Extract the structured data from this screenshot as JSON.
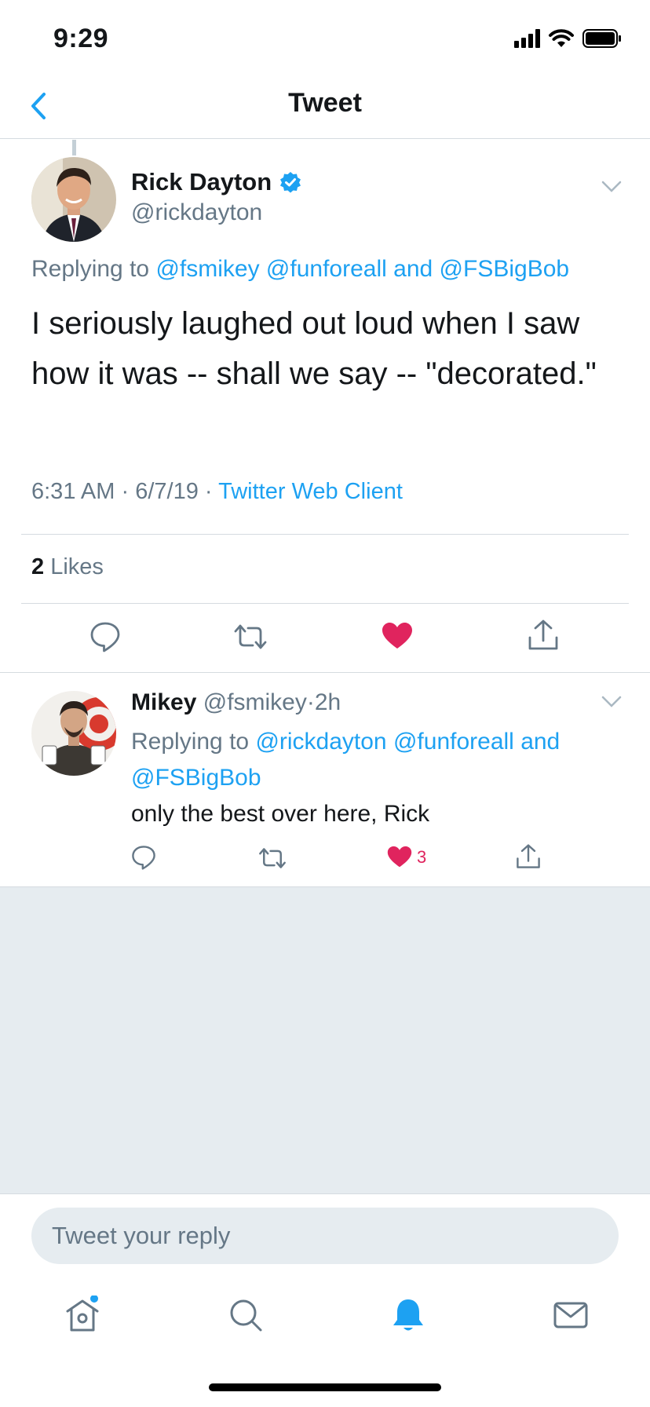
{
  "status_bar": {
    "time": "9:29"
  },
  "nav": {
    "title": "Tweet"
  },
  "main_tweet": {
    "author_name": "Rick Dayton",
    "author_handle": "@rickdayton",
    "replying_prefix": "Replying to ",
    "mention_1": "@fsmikey",
    "mention_2": "@funforeall",
    "and_word": "and",
    "mention_3": "@FSBigBob",
    "text": "I seriously laughed out loud when I saw how it was -- shall we say -- \"decorated.\"",
    "time": "6:31 AM",
    "date": "6/7/19",
    "separator": "·",
    "client": "Twitter Web Client",
    "likes_count": "2",
    "likes_label": "Likes"
  },
  "reply_tweet": {
    "author_name": "Mikey",
    "author_handle": "@fsmikey",
    "separator": "·",
    "age": "2h",
    "replying_prefix": "Replying to ",
    "mention_1": "@rickdayton",
    "mention_2": "@funforeall",
    "and_word": "and",
    "mention_3": "@FSBigBob",
    "text": "only the best over here, Rick",
    "like_count": "3"
  },
  "composer": {
    "placeholder": "Tweet your reply"
  },
  "colors": {
    "accent": "#1da1f2",
    "like": "#e0245e",
    "muted": "#657786",
    "background_gray": "#e6ecf0"
  },
  "icons": {
    "tweet_actions": [
      "reply-icon",
      "retweet-icon",
      "like-icon",
      "share-icon"
    ],
    "tab_bar": [
      "home-icon",
      "search-icon",
      "notifications-icon",
      "messages-icon"
    ]
  }
}
